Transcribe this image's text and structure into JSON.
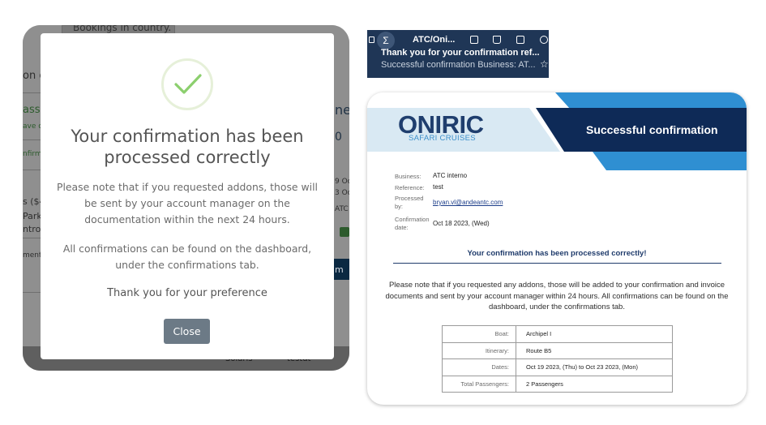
{
  "background_app": {
    "top_fragment": "Bookings in country.",
    "fragments": [
      "on c",
      "ass",
      "ave c",
      "nfirm",
      "s ($4",
      "Park",
      "ntrol C",
      "ment",
      "ne",
      "0",
      "9 Oc",
      "3 Oc",
      "ATC",
      "m"
    ],
    "bottom_row": [
      "Solaris",
      "testdt"
    ]
  },
  "modal": {
    "title": "Your confirmation has been processed correctly",
    "body_1": "Please note that if you requested addons, those will be sent by your account manager on the documentation within the next 24 hours.",
    "body_2": "All confirmations can be found on the dashboard, under the confirmations tab.",
    "thanks": "Thank you for your preference",
    "close_label": "Close",
    "check_color": "#8ccf6e"
  },
  "notification": {
    "avatar_glyph": "Σ",
    "app_name": "ATC/Oni...",
    "title": "Thank you for your confirmation ref...",
    "subtitle": "Successful confirmation Business: AT...",
    "icons": [
      "archive-icon",
      "trash-icon",
      "envelope-icon",
      "clock-icon",
      "star-icon"
    ],
    "star_glyph": "☆"
  },
  "email": {
    "logo_text": "ONIRIC",
    "logo_sub": "SAFARI CRUISES",
    "header_title": "Successful confirmation",
    "brand_colors": {
      "navy": "#0e2a57",
      "blue": "#2f8fd2",
      "light": "#d9e9f3"
    },
    "info": [
      {
        "label": "Business:",
        "value": "ATC interno"
      },
      {
        "label": "Reference:",
        "value": "test"
      },
      {
        "label": "Processed by:",
        "value": "bryan.vl@andeantc.com"
      },
      {
        "label": "Confirmation date:",
        "value": "Oct 18 2023, (Wed)"
      }
    ],
    "heading": "Your confirmation has been processed correctly!",
    "body": "Please note that if you requested any addons, those will be added to your confirmation and invoice documents and sent by your account manager within 24 hours. All confirmations can be found on the dashboard, under the confirmations tab.",
    "table": [
      {
        "key": "Boat:",
        "value": "Archipel I"
      },
      {
        "key": "Itinerary:",
        "value": "Route B5"
      },
      {
        "key": "Dates:",
        "value": "Oct 19 2023, (Thu) to Oct 23 2023, (Mon)"
      },
      {
        "key": "Total Passengers:",
        "value": "2 Passengers"
      }
    ]
  }
}
